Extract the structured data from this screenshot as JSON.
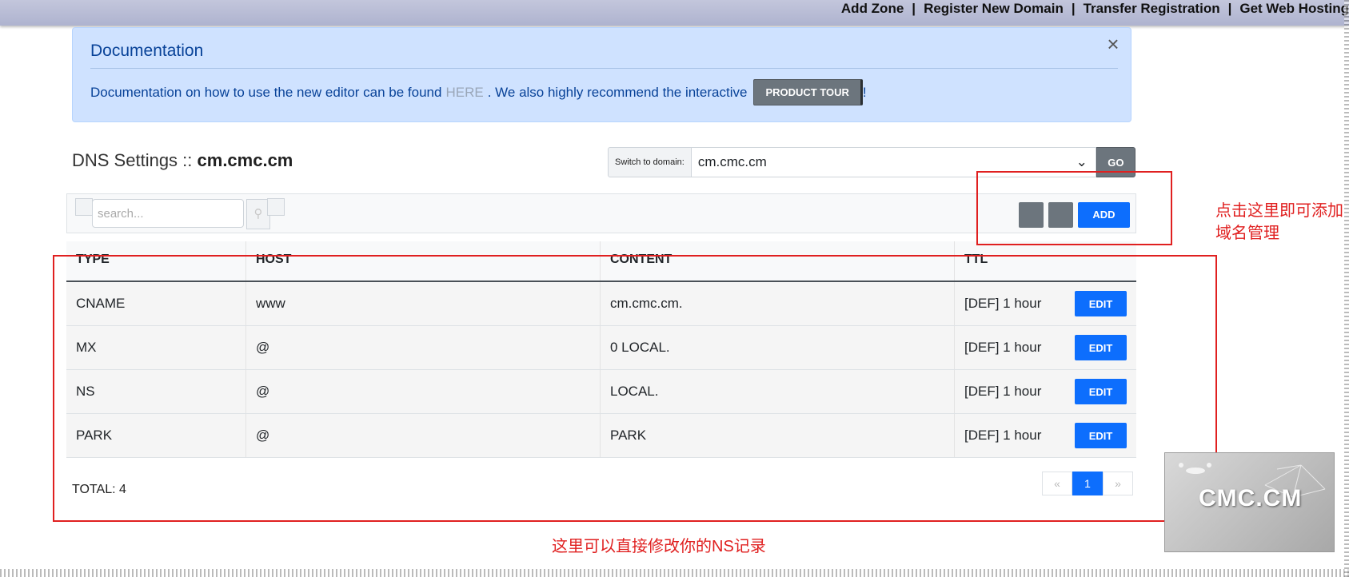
{
  "topnav": [
    "Add Zone",
    "Register New Domain",
    "Transfer Registration",
    "Get Web Hosting"
  ],
  "doc": {
    "title": "Documentation",
    "text_before": "Documentation on how to use the new editor can be found",
    "link": "HERE",
    "text_after": ". We also highly recommend the interactive",
    "tour_button": "PRODUCT TOUR",
    "text_end": "!"
  },
  "dns": {
    "title_prefix": "DNS Settings ::",
    "domain": "cm.cmc.cm"
  },
  "switch": {
    "label": "Switch to domain:",
    "value": "cm.cmc.cm",
    "go": "GO"
  },
  "search": {
    "placeholder": "search..."
  },
  "add_label": "ADD",
  "table": {
    "headers": [
      "TYPE",
      "HOST",
      "CONTENT",
      "TTL"
    ],
    "rows": [
      {
        "type": "CNAME",
        "host": "www",
        "content": "cm.cmc.cm.",
        "ttl": "[DEF] 1 hour",
        "action": "EDIT"
      },
      {
        "type": "MX",
        "host": "@",
        "content": "0 LOCAL.",
        "ttl": "[DEF] 1 hour",
        "action": "EDIT"
      },
      {
        "type": "NS",
        "host": "@",
        "content": "LOCAL.",
        "ttl": "[DEF] 1 hour",
        "action": "EDIT"
      },
      {
        "type": "PARK",
        "host": "@",
        "content": "PARK",
        "ttl": "[DEF] 1 hour",
        "action": "EDIT"
      }
    ]
  },
  "total": "TOTAL: 4",
  "pager": {
    "prev": "«",
    "current": "1",
    "next": "»"
  },
  "annotations": {
    "add_note_line1": "点击这里即可添加",
    "add_note_line2": "域名管理",
    "table_note": "这里可以直接修改你的NS记录"
  },
  "watermark": "CMC.CM",
  "colors": {
    "primary": "#0d6efd",
    "secondary": "#6c757d",
    "annotation": "#e02020",
    "alert_bg": "#cfe2ff"
  }
}
